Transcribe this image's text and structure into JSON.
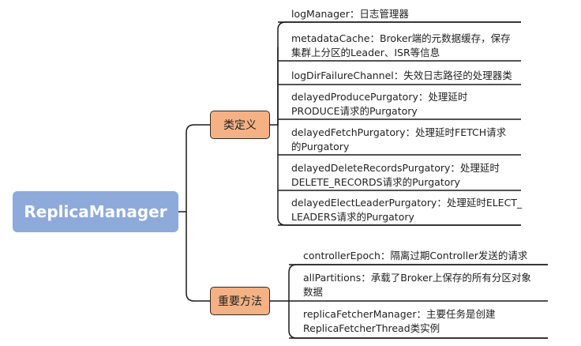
{
  "root": {
    "label": "ReplicaManager"
  },
  "branches": [
    {
      "label": "类定义",
      "items": [
        {
          "lines": [
            "logManager：日志管理器"
          ]
        },
        {
          "lines": [
            "metadataCache：Broker端的元数据缓存，保存",
            "集群上分区的Leader、ISR等信息"
          ]
        },
        {
          "lines": [
            "logDirFailureChannel：失效日志路径的处理器类"
          ]
        },
        {
          "lines": [
            "delayedProducePurgatory：处理延时",
            "PRODUCE请求的Purgatory"
          ]
        },
        {
          "lines": [
            "delayedFetchPurgatory：处理延时FETCH请求",
            "的Purgatory"
          ]
        },
        {
          "lines": [
            "delayedDeleteRecordsPurgatory：处理延时",
            "DELETE_RECORDS请求的Purgatory"
          ]
        },
        {
          "lines": [
            "delayedElectLeaderPurgatory：处理延时ELECT_",
            "LEADERS请求的Purgatory"
          ]
        }
      ]
    },
    {
      "label": "重要方法",
      "items": [
        {
          "lines": [
            "controllerEpoch：隔离过期Controller发送的请求"
          ]
        },
        {
          "lines": [
            "allPartitions：承载了Broker上保存的所有分区对象",
            "数据"
          ]
        },
        {
          "lines": [
            "replicaFetcherManager：主要任务是创建",
            "ReplicaFetcherThread类实例"
          ]
        }
      ]
    }
  ]
}
